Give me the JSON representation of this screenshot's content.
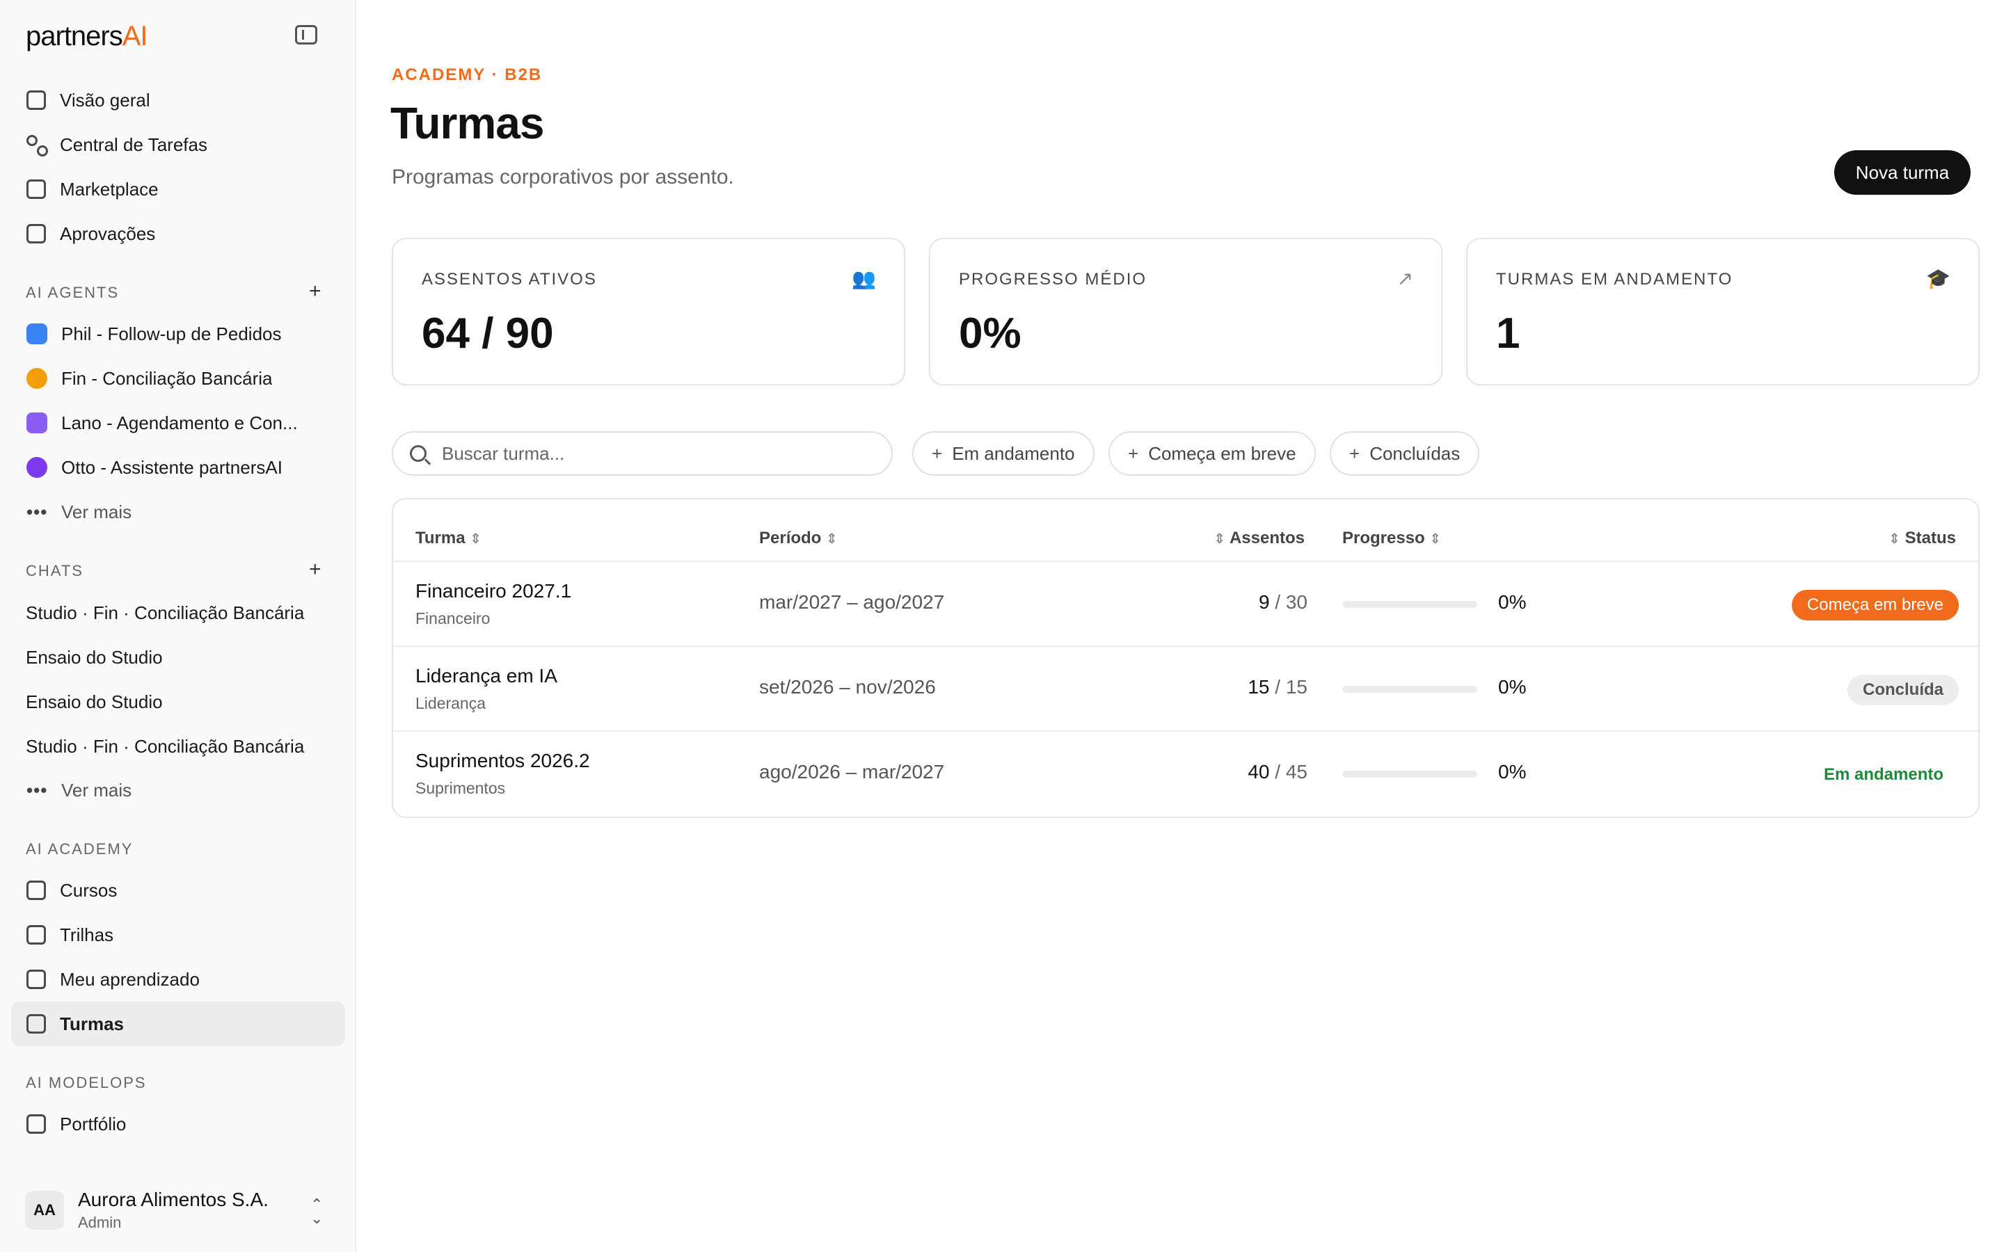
{
  "sidebar": {
    "brand": {
      "text": "partners",
      "accent": "AI"
    },
    "nav": [
      {
        "label": "Visão geral",
        "icon": "home-icon"
      },
      {
        "label": "Central de Tarefas",
        "icon": "grid-icon"
      },
      {
        "label": "Marketplace",
        "icon": "store-icon"
      },
      {
        "label": "Aprovações",
        "icon": "clipboard-check-icon"
      }
    ],
    "agents_title": "AI AGENTS",
    "agents": [
      {
        "label": "Phil - Follow-up de Pedidos",
        "color": "#3b82f6"
      },
      {
        "label": "Fin - Conciliação Bancária",
        "color": "#f59e0b"
      },
      {
        "label": "Lano - Agendamento e Con...",
        "color": "#8b5cf6"
      },
      {
        "label": "Otto - Assistente partnersAI",
        "color": "#7c3aed"
      }
    ],
    "agents_more": "Ver mais",
    "chats_title": "CHATS",
    "chats": [
      "Studio · Fin · Conciliação Bancária",
      "Ensaio do Studio",
      "Ensaio do Studio",
      "Studio · Fin · Conciliação Bancária"
    ],
    "chats_more": "Ver mais",
    "academy_title": "AI ACADEMY",
    "academy": [
      {
        "label": "Cursos",
        "icon": "graduation-cap-icon"
      },
      {
        "label": "Trilhas",
        "icon": "signpost-icon"
      },
      {
        "label": "Meu aprendizado",
        "icon": "book-open-icon"
      },
      {
        "label": "Turmas",
        "icon": "school-icon",
        "active": true
      }
    ],
    "modelops_title": "AI MODELOPS",
    "modelops": [
      {
        "label": "Portfólio",
        "icon": "layers-icon"
      }
    ],
    "account": {
      "initials": "AA",
      "name": "Aurora Alimentos S.A.",
      "role": "Admin"
    }
  },
  "header": {
    "eyebrow": "ACADEMY · B2B",
    "title": "Turmas",
    "subtitle": "Programas corporativos por assento.",
    "primary_button": "Nova turma"
  },
  "stats": [
    {
      "label": "ASSENTOS ATIVOS",
      "value": "64 / 90",
      "icon": "users-icon"
    },
    {
      "label": "PROGRESSO MÉDIO",
      "value": "0%",
      "icon": "trending-up-icon"
    },
    {
      "label": "TURMAS EM ANDAMENTO",
      "value": "1",
      "icon": "graduation-cap-icon"
    }
  ],
  "filters": {
    "search_placeholder": "Buscar turma...",
    "chips": [
      "Em andamento",
      "Começa em breve",
      "Concluídas"
    ]
  },
  "table": {
    "columns": {
      "turma": "Turma",
      "periodo": "Período",
      "assentos": "Assentos",
      "progresso": "Progresso",
      "status": "Status"
    },
    "rows": [
      {
        "name": "Financeiro 2027.1",
        "area": "Financeiro",
        "period": "mar/2027 – ago/2027",
        "seats_used": "9",
        "seats_total": "/ 30",
        "progress": 0,
        "progress_label": "0%",
        "status": "Começa em breve",
        "status_kind": "soon"
      },
      {
        "name": "Liderança em IA",
        "area": "Liderança",
        "period": "set/2026 – nov/2026",
        "seats_used": "15",
        "seats_total": "/ 15",
        "progress": 0,
        "progress_label": "0%",
        "status": "Concluída",
        "status_kind": "done"
      },
      {
        "name": "Suprimentos 2026.2",
        "area": "Suprimentos",
        "period": "ago/2026 – mar/2027",
        "seats_used": "40",
        "seats_total": "/ 45",
        "progress": 0,
        "progress_label": "0%",
        "status": "Em andamento",
        "status_kind": "ongoing"
      }
    ]
  },
  "colors": {
    "accent": "#f26a1b",
    "success": "#1f8a3a",
    "primary_button": "#111111"
  }
}
